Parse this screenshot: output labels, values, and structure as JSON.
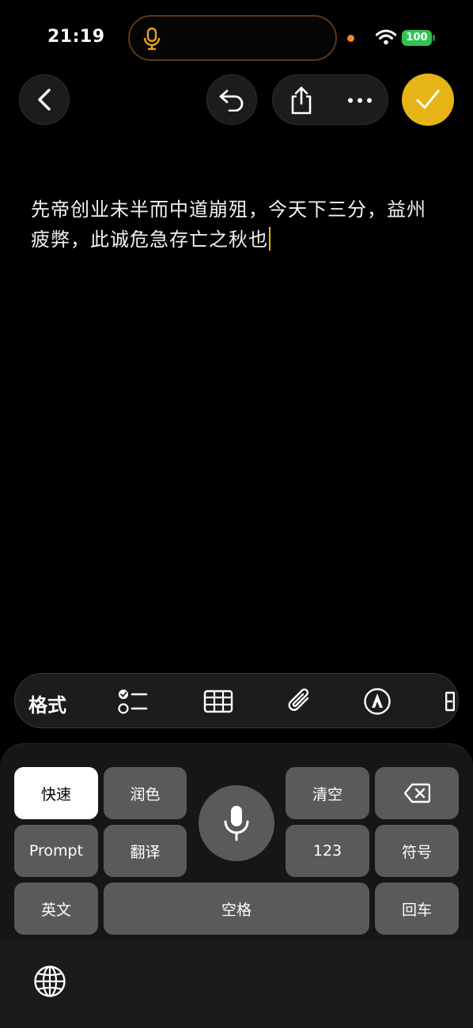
{
  "status_bar": {
    "time": "21:19",
    "battery": "100",
    "accent": "#e6b416",
    "battery_color": "#31c453"
  },
  "nav": {
    "back_icon": "chevron-left-icon",
    "undo_icon": "undo-icon",
    "share_icon": "share-icon",
    "more_icon": "ellipsis-icon",
    "done_icon": "checkmark-icon"
  },
  "note": {
    "text": "先帝创业未半而中道崩殂，今天下三分，益州疲弊，此诚危急存亡之秋也"
  },
  "format_bar": {
    "format_label": "格式",
    "icons": [
      "checklist-icon",
      "table-icon",
      "paperclip-icon",
      "markup-icon",
      "more-icon"
    ]
  },
  "keyboard": {
    "fast": "快速",
    "polish": "润色",
    "clear": "清空",
    "prompt": "Prompt",
    "translate": "翻译",
    "numbers": "123",
    "symbols": "符号",
    "english": "英文",
    "space": "空格",
    "return": "回车",
    "globe_icon": "globe-icon"
  }
}
